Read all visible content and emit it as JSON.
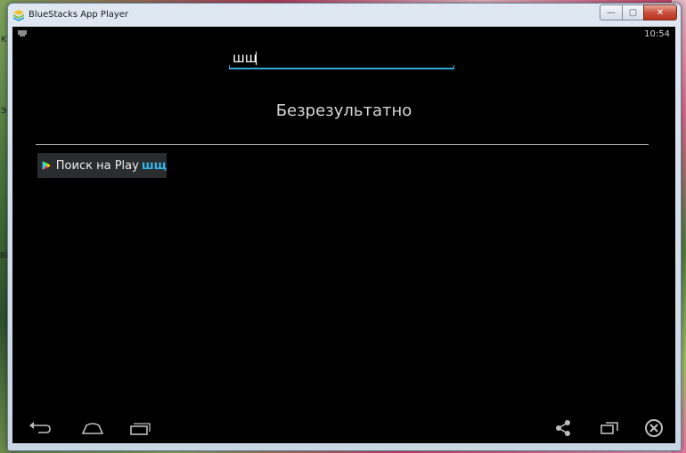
{
  "window": {
    "title": "BlueStacks App Player",
    "controls": {
      "minimize_glyph": "—",
      "maximize_glyph": "▢",
      "close_glyph": "✕"
    }
  },
  "status_bar": {
    "time": "10:54",
    "left_icon": "notification-icon"
  },
  "search": {
    "value": "шщ"
  },
  "results": {
    "empty_message": "Безрезультатно"
  },
  "play_search": {
    "label": "Поиск на Play",
    "query": "шщ",
    "icon": "play-store-icon",
    "accent": "#33b5e5"
  },
  "nav_bar": {
    "back_icon": "back-icon",
    "home_icon": "home-icon",
    "recents_icon": "recent-apps-icon",
    "share_icon": "share-icon",
    "rotate_icon": "screen-rotate-icon",
    "close_icon": "close-icon"
  },
  "desktop": {
    "edge_letters": [
      "К",
      "Э",
      "Ві"
    ]
  },
  "colors": {
    "accent": "#33a7d8",
    "screen_bg": "#000000",
    "text_light": "#d8d8d8"
  }
}
